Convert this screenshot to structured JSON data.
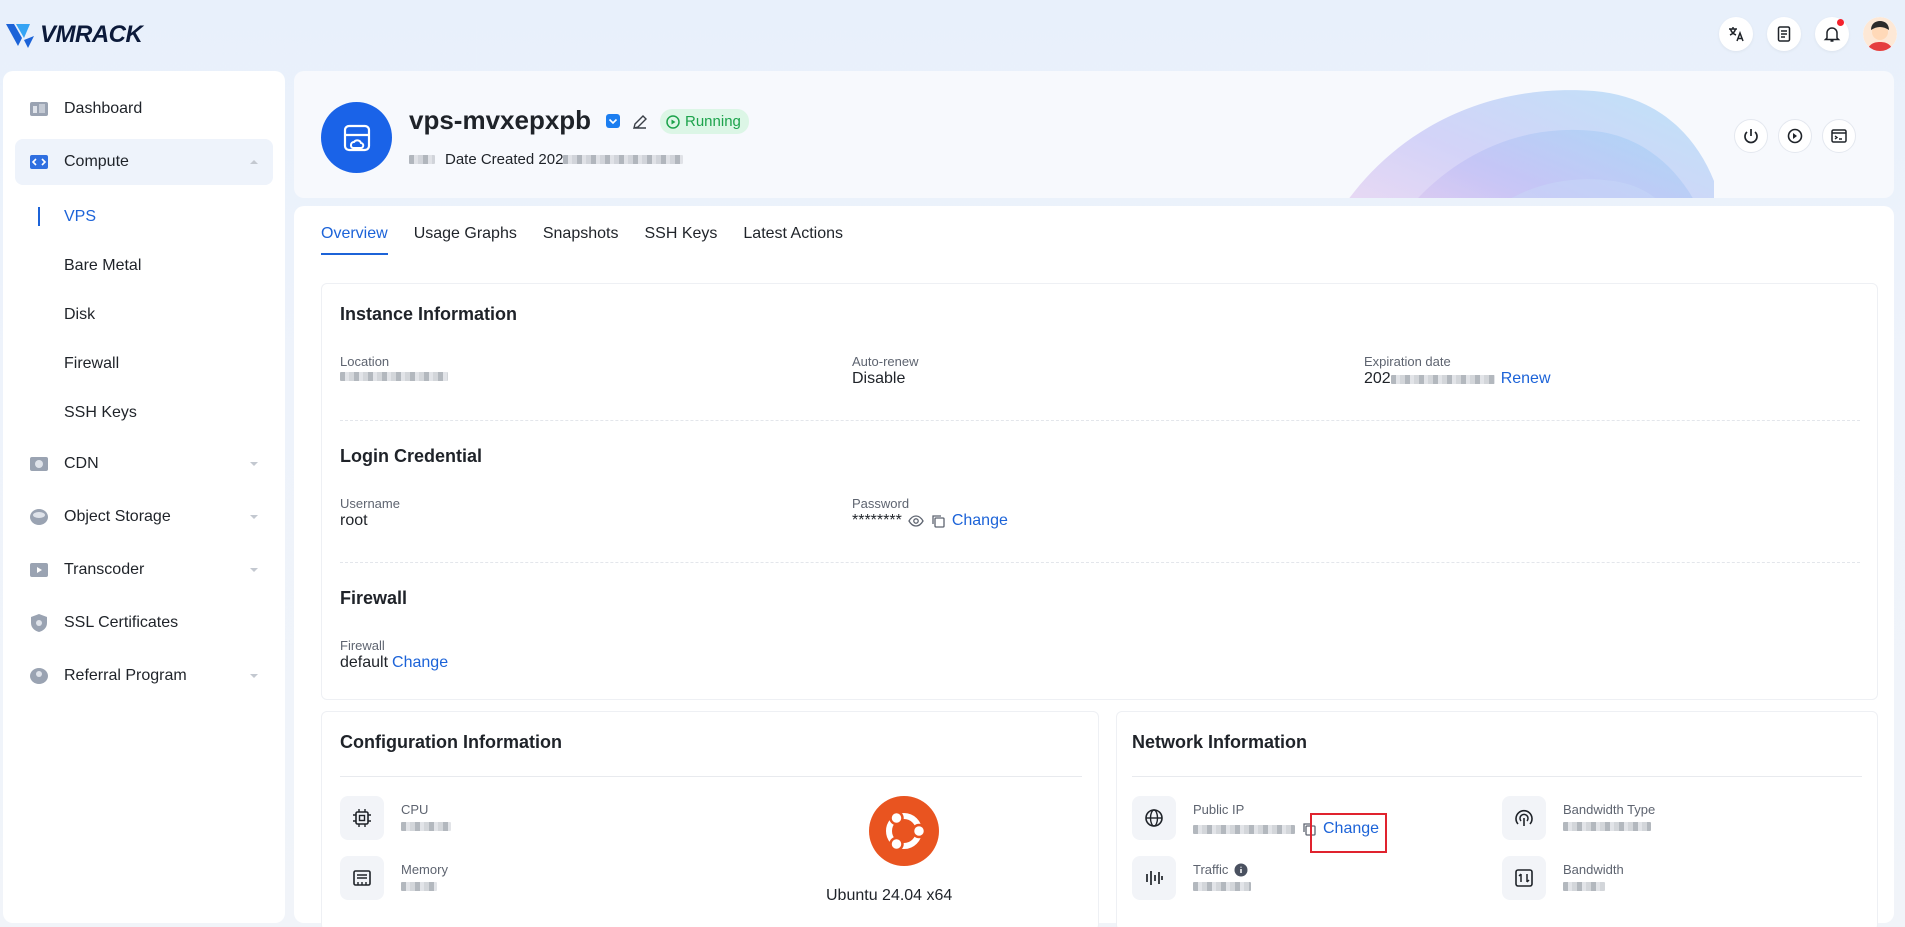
{
  "brand": {
    "name": "VMRACK",
    "accent": "#1c63d8"
  },
  "sidebar": {
    "items": [
      {
        "label": "Dashboard"
      },
      {
        "label": "Compute"
      },
      {
        "label": "CDN"
      },
      {
        "label": "Object Storage"
      },
      {
        "label": "Transcoder"
      },
      {
        "label": "SSL Certificates"
      },
      {
        "label": "Referral Program"
      }
    ],
    "compute_sub": [
      {
        "label": "VPS"
      },
      {
        "label": "Bare Metal"
      },
      {
        "label": "Disk"
      },
      {
        "label": "Firewall"
      },
      {
        "label": "SSH Keys"
      }
    ]
  },
  "header": {
    "title": "vps-mvxepxpb",
    "status": "Running",
    "date_created_label": "Date Created 202"
  },
  "tabs": [
    "Overview",
    "Usage Graphs",
    "Snapshots",
    "SSH Keys",
    "Latest Actions"
  ],
  "instance": {
    "title": "Instance Information",
    "location_label": "Location",
    "auto_renew_label": "Auto-renew",
    "auto_renew_value": "Disable",
    "expiration_label": "Expiration date",
    "expiration_prefix": "202",
    "renew_link": "Renew"
  },
  "login": {
    "title": "Login Credential",
    "username_label": "Username",
    "username_value": "root",
    "password_label": "Password",
    "password_value": "********",
    "change_link": "Change"
  },
  "firewall": {
    "title": "Firewall",
    "label": "Firewall",
    "value": "default",
    "change_link": "Change"
  },
  "configuration": {
    "title": "Configuration Information",
    "cpu_label": "CPU",
    "memory_label": "Memory",
    "os_label": "Ubuntu 24.04 x64"
  },
  "network": {
    "title": "Network Information",
    "public_ip_label": "Public IP",
    "change_link": "Change",
    "traffic_label": "Traffic",
    "bandwidth_type_label": "Bandwidth Type",
    "bandwidth_label": "Bandwidth"
  }
}
